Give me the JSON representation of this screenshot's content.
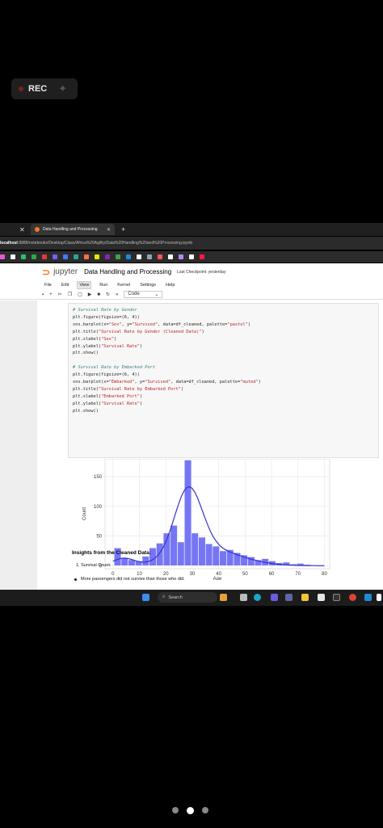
{
  "recorder": {
    "label": "REC"
  },
  "browser": {
    "tab_title": "Data Handling and Processing",
    "url_prefix": "localhost",
    "url_rest": ":8888/notebooks/Desktop/Class/Africa%20Agility/Data%20Handling%20and%20Processing.ipynb"
  },
  "jupyter": {
    "logo_word": "jupyter",
    "notebook_title": "Data Handling and Processing",
    "checkpoint": "Last Checkpoint: yesterday",
    "menu": [
      "File",
      "Edit",
      "View",
      "Run",
      "Kernel",
      "Settings",
      "Help"
    ],
    "active_menu": "View",
    "cell_type": "Code"
  },
  "code_lines": [
    {
      "c": "# Survival Rate by Gender"
    },
    {
      "t": "plt.figure(figsize=(6, 4))"
    },
    {
      "t": "sns.barplot(x=\"Sex\", y=\"Survived\", data=df_cleaned, palette=\"pastel\")"
    },
    {
      "t": "plt.title(\"Survival Rate by Gender (Cleaned Data)\")"
    },
    {
      "t": "plt.xlabel(\"Sex\")"
    },
    {
      "t": "plt.ylabel(\"Survival Rate\")"
    },
    {
      "t": "plt.show()"
    },
    {
      "t": ""
    },
    {
      "c": "# Survival Rate by Embarked Port"
    },
    {
      "t": "plt.figure(figsize=(6, 4))"
    },
    {
      "t": "sns.barplot(x=\"Embarked\", y=\"Survived\", data=df_cleaned, palette=\"muted\")"
    },
    {
      "t": "plt.title(\"Survival Rate by Embarked Port\")"
    },
    {
      "t": "plt.xlabel(\"Embarked Port\")"
    },
    {
      "t": "plt.ylabel(\"Survival Rate\")"
    },
    {
      "t": "plt.show()"
    }
  ],
  "chart_data": {
    "type": "bar",
    "xlabel": "Age",
    "ylabel": "Count",
    "xlim": [
      -3,
      82
    ],
    "ylim": [
      -5,
      180
    ],
    "x_ticks": [
      0,
      10,
      20,
      30,
      40,
      50,
      60,
      70,
      80
    ],
    "y_ticks": [
      0,
      50,
      100,
      150
    ],
    "bin_width": 2.66,
    "bins_left": [
      0.42,
      3.08,
      5.74,
      8.4,
      11.06,
      13.72,
      16.38,
      19.04,
      21.7,
      24.36,
      27.02,
      29.68,
      32.34,
      35.0,
      37.66,
      40.32,
      42.98,
      45.64,
      48.3,
      50.96,
      53.62,
      56.28,
      58.94,
      61.6,
      64.26,
      66.92,
      69.58,
      72.24,
      74.9,
      77.56
    ],
    "counts": [
      30,
      13,
      10,
      8,
      16,
      30,
      38,
      55,
      68,
      40,
      178,
      55,
      48,
      37,
      33,
      25,
      27,
      22,
      18,
      15,
      10,
      12,
      8,
      5,
      6,
      3,
      4,
      2,
      1,
      1
    ],
    "kde_curve_color": "#3333cc",
    "bar_color": "#6b6bf5",
    "grid": true
  },
  "markdown": {
    "heading": "Insights from the Cleaned Data:",
    "list_item": "1. Survival Count:",
    "bullet": "More passengers did not survive than those who did."
  },
  "taskbar": {
    "search_label": "Search"
  }
}
